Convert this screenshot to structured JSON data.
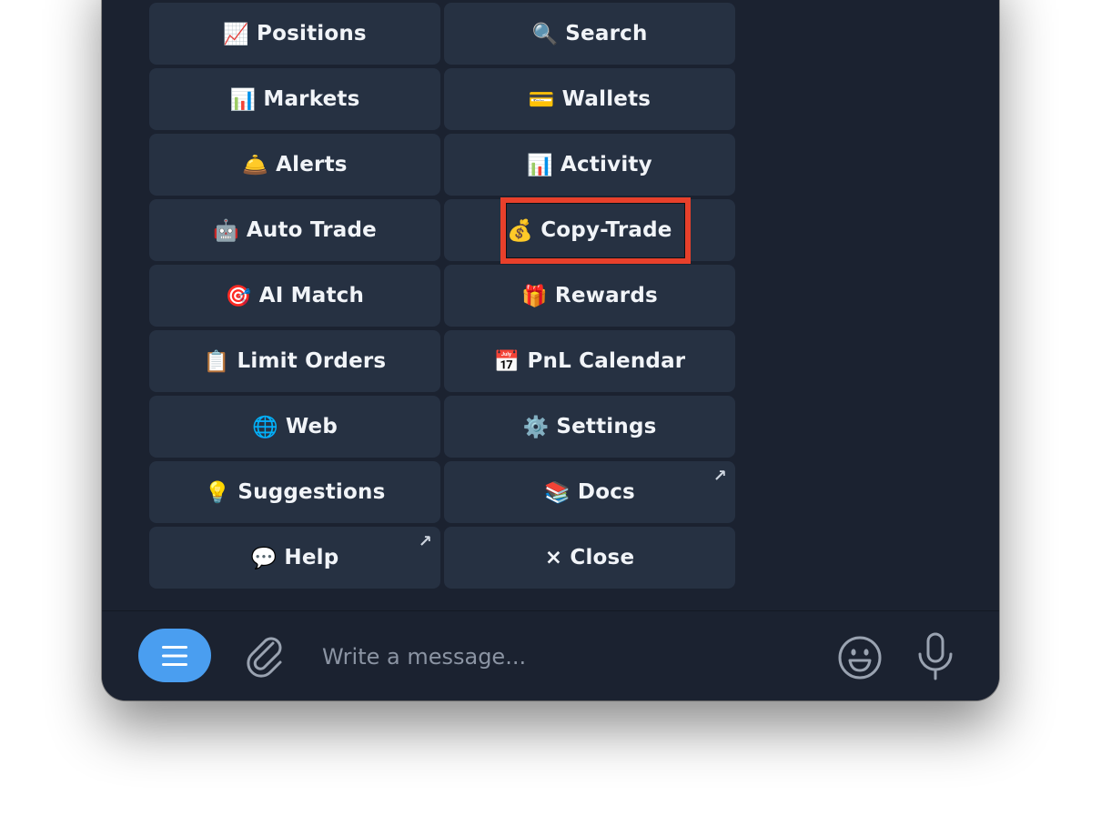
{
  "keyboard": {
    "buttons": [
      {
        "emoji": "📈",
        "label": "Positions",
        "external": false
      },
      {
        "emoji": "🔍",
        "label": "Search",
        "external": false
      },
      {
        "emoji": "📊",
        "label": "Markets",
        "external": false
      },
      {
        "emoji": "💳",
        "label": "Wallets",
        "external": false
      },
      {
        "emoji": "🛎️",
        "label": "Alerts",
        "external": false
      },
      {
        "emoji": "📊",
        "label": "Activity",
        "external": false
      },
      {
        "emoji": "🤖",
        "label": "Auto Trade",
        "external": false
      },
      {
        "emoji": "💰",
        "label": "Copy-Trade",
        "external": false
      },
      {
        "emoji": "🎯",
        "label": "AI Match",
        "external": false
      },
      {
        "emoji": "🎁",
        "label": "Rewards",
        "external": false
      },
      {
        "emoji": "📋",
        "label": "Limit Orders",
        "external": false
      },
      {
        "emoji": "📅",
        "label": "PnL Calendar",
        "external": false
      },
      {
        "emoji": "🌐",
        "label": "Web",
        "external": false
      },
      {
        "emoji": "⚙️",
        "label": "Settings",
        "external": false
      },
      {
        "emoji": "💡",
        "label": "Suggestions",
        "external": false
      },
      {
        "emoji": "📚",
        "label": "Docs",
        "external": true
      },
      {
        "emoji": "💬",
        "label": "Help",
        "external": true
      },
      {
        "emoji": "",
        "label": "× Close",
        "external": false
      }
    ],
    "external_glyph": "↗",
    "highlighted_button": "Copy-Trade"
  },
  "composer": {
    "placeholder": "Write a message...",
    "icons": [
      "menu-icon",
      "paperclip-icon",
      "smiley-icon",
      "microphone-icon"
    ]
  },
  "colors": {
    "window_bg": "#1b2230",
    "button_bg": "#263142",
    "menu_button": "#4a9ef0",
    "highlight": "#e8402b"
  }
}
